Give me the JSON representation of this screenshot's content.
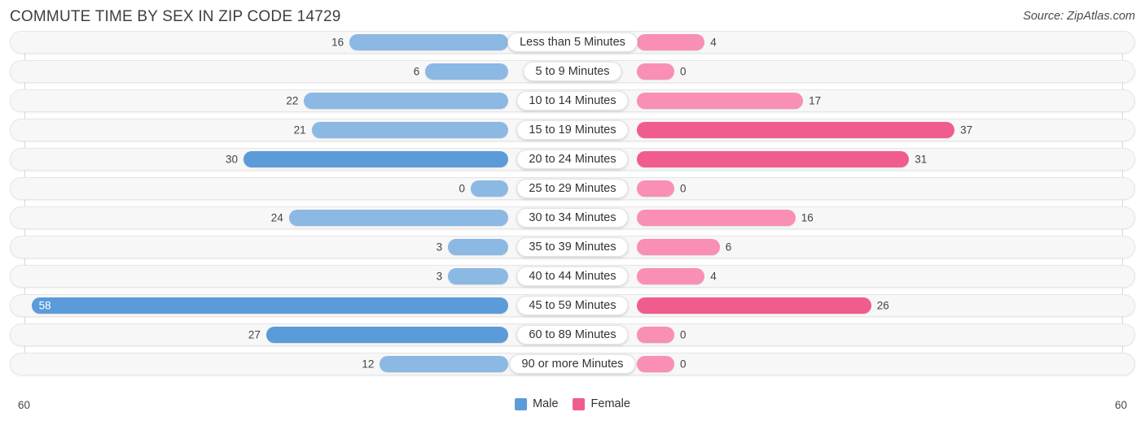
{
  "header": {
    "title": "COMMUTE TIME BY SEX IN ZIP CODE 14729",
    "source": "Source: ZipAtlas.com"
  },
  "axis": {
    "left_tick": "60",
    "right_tick": "60"
  },
  "legend": {
    "items": [
      {
        "label": "Male",
        "color": "#5B9BD9"
      },
      {
        "label": "Female",
        "color": "#F05C8B"
      }
    ]
  },
  "colors": {
    "male_light": "#8CB8E4",
    "male_dark": "#5B9BD9",
    "female_light": "#F98FB4",
    "female_dark": "#F05C8B",
    "track": "#f7f7f7"
  },
  "chart_data": {
    "type": "bar",
    "orientation": "horizontal-diverging",
    "title": "COMMUTE TIME BY SEX IN ZIP CODE 14729",
    "xlabel": "",
    "ylabel": "",
    "xlim": [
      -60,
      60
    ],
    "axis_max": 60,
    "grid": false,
    "legend_position": "bottom-center",
    "categories": [
      "Less than 5 Minutes",
      "5 to 9 Minutes",
      "10 to 14 Minutes",
      "15 to 19 Minutes",
      "20 to 24 Minutes",
      "25 to 29 Minutes",
      "30 to 34 Minutes",
      "35 to 39 Minutes",
      "40 to 44 Minutes",
      "45 to 59 Minutes",
      "60 to 89 Minutes",
      "90 or more Minutes"
    ],
    "series": [
      {
        "name": "Male",
        "values": [
          16,
          6,
          22,
          21,
          30,
          0,
          24,
          3,
          3,
          58,
          27,
          12
        ]
      },
      {
        "name": "Female",
        "values": [
          4,
          0,
          17,
          37,
          31,
          0,
          16,
          6,
          4,
          26,
          0,
          0
        ]
      }
    ]
  },
  "rows": [
    {
      "label": "Less than 5 Minutes",
      "male": 16,
      "female": 4,
      "male_text": "16",
      "female_text": "4"
    },
    {
      "label": "5 to 9 Minutes",
      "male": 6,
      "female": 0,
      "male_text": "6",
      "female_text": "0"
    },
    {
      "label": "10 to 14 Minutes",
      "male": 22,
      "female": 17,
      "male_text": "22",
      "female_text": "17"
    },
    {
      "label": "15 to 19 Minutes",
      "male": 21,
      "female": 37,
      "male_text": "21",
      "female_text": "37"
    },
    {
      "label": "20 to 24 Minutes",
      "male": 30,
      "female": 31,
      "male_text": "30",
      "female_text": "31"
    },
    {
      "label": "25 to 29 Minutes",
      "male": 0,
      "female": 0,
      "male_text": "0",
      "female_text": "0"
    },
    {
      "label": "30 to 34 Minutes",
      "male": 24,
      "female": 16,
      "male_text": "24",
      "female_text": "16"
    },
    {
      "label": "35 to 39 Minutes",
      "male": 3,
      "female": 6,
      "male_text": "3",
      "female_text": "6"
    },
    {
      "label": "40 to 44 Minutes",
      "male": 3,
      "female": 4,
      "male_text": "3",
      "female_text": "4"
    },
    {
      "label": "45 to 59 Minutes",
      "male": 58,
      "female": 26,
      "male_text": "58",
      "female_text": "26"
    },
    {
      "label": "60 to 89 Minutes",
      "male": 27,
      "female": 0,
      "male_text": "27",
      "female_text": "0"
    },
    {
      "label": "90 or more Minutes",
      "male": 12,
      "female": 0,
      "male_text": "12",
      "female_text": "0"
    }
  ]
}
